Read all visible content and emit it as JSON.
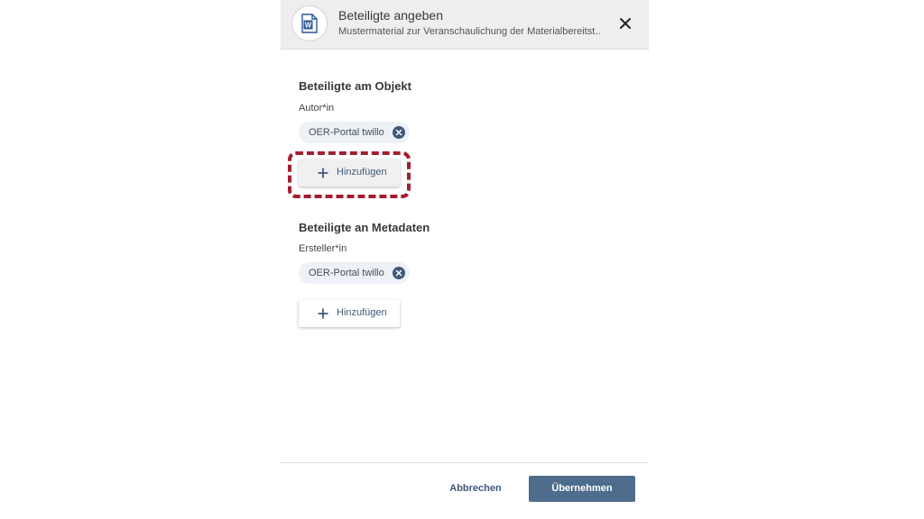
{
  "dialog": {
    "title": "Beteiligte angeben",
    "subtitle": "Mustermaterial zur Veranschaulichung der Materialbereitst…",
    "file_icon": "word-document-icon",
    "close_icon": "close-icon"
  },
  "sections": [
    {
      "title": "Beteiligte am Objekt",
      "role_label": "Autor*in",
      "chip_label": "OER-Portal twillo",
      "add_label": "Hinzufügen"
    },
    {
      "title": "Beteiligte an Metadaten",
      "role_label": "Ersteller*in",
      "chip_label": "OER-Portal twillo",
      "add_label": "Hinzufügen"
    }
  ],
  "footer": {
    "cancel_label": "Abbrechen",
    "apply_label": "Übernehmen"
  },
  "colors": {
    "accent": "#4e6d8d",
    "highlight": "#a31e2e",
    "header_bg": "#eeeeee"
  }
}
